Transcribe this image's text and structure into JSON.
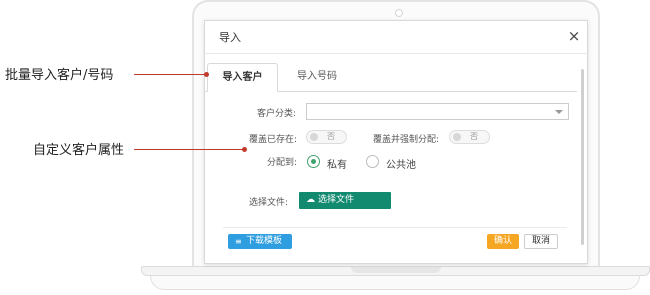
{
  "dialog": {
    "title": "导入",
    "close_icon": "×"
  },
  "tabs": [
    {
      "label": "导入客户",
      "active": true
    },
    {
      "label": "导入号码",
      "active": false
    }
  ],
  "form": {
    "customer_category_label": "客户分类:",
    "customer_category_value": "",
    "overwrite_existing_label": "覆盖已存在:",
    "overwrite_existing_toggle": "否",
    "overwrite_force_assign_label": "覆盖并强制分配:",
    "overwrite_force_assign_toggle": "否",
    "assign_to_label": "分配到:",
    "assign_options": [
      {
        "label": "私有",
        "checked": true
      },
      {
        "label": "公共池",
        "checked": false
      }
    ],
    "choose_file_label": "选择文件:",
    "choose_file_button": "选择文件",
    "choose_file_icon": "☁"
  },
  "footer": {
    "download_template": "下载模板",
    "download_icon": "≡",
    "confirm": "确认",
    "cancel": "取消"
  },
  "callouts": [
    {
      "text": "批量导入客户/号码"
    },
    {
      "text": "自定义客户属性"
    }
  ],
  "colors": {
    "accent_red": "#c0392b",
    "green": "#128a70",
    "blue": "#2f9ee0",
    "orange": "#f5a623"
  }
}
